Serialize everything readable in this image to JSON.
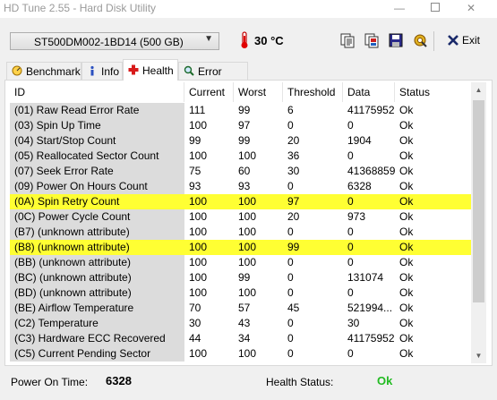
{
  "window": {
    "title": "HD Tune 2.55 - Hard Disk Utility",
    "minimize": "—",
    "close": "✕"
  },
  "toolbar": {
    "drive": "ST500DM002-1BD14 (500 GB)",
    "temperature": "30 °C",
    "exit_label": "Exit",
    "icons": [
      "copy-text-icon",
      "copy-screenshot-icon",
      "save-icon",
      "options-icon",
      "exit-icon"
    ]
  },
  "tabs": [
    {
      "label": "Benchmark",
      "icon": "benchmark-icon",
      "active": false
    },
    {
      "label": "Info",
      "icon": "info-icon",
      "active": false
    },
    {
      "label": "Health",
      "icon": "health-icon",
      "active": true
    },
    {
      "label": "Error Scan",
      "icon": "error-scan-icon",
      "active": false
    }
  ],
  "table": {
    "columns": [
      "ID",
      "Current",
      "Worst",
      "Threshold",
      "Data",
      "Status"
    ],
    "rows": [
      {
        "id": "(01) Raw Read Error Rate",
        "current": "111",
        "worst": "99",
        "threshold": "6",
        "data": "41175952",
        "status": "Ok",
        "highlight": false
      },
      {
        "id": "(03) Spin Up Time",
        "current": "100",
        "worst": "97",
        "threshold": "0",
        "data": "0",
        "status": "Ok",
        "highlight": false
      },
      {
        "id": "(04) Start/Stop Count",
        "current": "99",
        "worst": "99",
        "threshold": "20",
        "data": "1904",
        "status": "Ok",
        "highlight": false
      },
      {
        "id": "(05) Reallocated Sector Count",
        "current": "100",
        "worst": "100",
        "threshold": "36",
        "data": "0",
        "status": "Ok",
        "highlight": false
      },
      {
        "id": "(07) Seek Error Rate",
        "current": "75",
        "worst": "60",
        "threshold": "30",
        "data": "41368859",
        "status": "Ok",
        "highlight": false
      },
      {
        "id": "(09) Power On Hours Count",
        "current": "93",
        "worst": "93",
        "threshold": "0",
        "data": "6328",
        "status": "Ok",
        "highlight": false
      },
      {
        "id": "(0A) Spin Retry Count",
        "current": "100",
        "worst": "100",
        "threshold": "97",
        "data": "0",
        "status": "Ok",
        "highlight": true
      },
      {
        "id": "(0C) Power Cycle Count",
        "current": "100",
        "worst": "100",
        "threshold": "20",
        "data": "973",
        "status": "Ok",
        "highlight": false
      },
      {
        "id": "(B7) (unknown attribute)",
        "current": "100",
        "worst": "100",
        "threshold": "0",
        "data": "0",
        "status": "Ok",
        "highlight": false
      },
      {
        "id": "(B8) (unknown attribute)",
        "current": "100",
        "worst": "100",
        "threshold": "99",
        "data": "0",
        "status": "Ok",
        "highlight": true
      },
      {
        "id": "(BB) (unknown attribute)",
        "current": "100",
        "worst": "100",
        "threshold": "0",
        "data": "0",
        "status": "Ok",
        "highlight": false
      },
      {
        "id": "(BC) (unknown attribute)",
        "current": "100",
        "worst": "99",
        "threshold": "0",
        "data": "131074",
        "status": "Ok",
        "highlight": false
      },
      {
        "id": "(BD) (unknown attribute)",
        "current": "100",
        "worst": "100",
        "threshold": "0",
        "data": "0",
        "status": "Ok",
        "highlight": false
      },
      {
        "id": "(BE) Airflow Temperature",
        "current": "70",
        "worst": "57",
        "threshold": "45",
        "data": "521994...",
        "status": "Ok",
        "highlight": false
      },
      {
        "id": "(C2) Temperature",
        "current": "30",
        "worst": "43",
        "threshold": "0",
        "data": "30",
        "status": "Ok",
        "highlight": false
      },
      {
        "id": "(C3) Hardware ECC Recovered",
        "current": "44",
        "worst": "34",
        "threshold": "0",
        "data": "41175952",
        "status": "Ok",
        "highlight": false
      },
      {
        "id": "(C5) Current Pending Sector",
        "current": "100",
        "worst": "100",
        "threshold": "0",
        "data": "0",
        "status": "Ok",
        "highlight": false
      }
    ]
  },
  "status_bar": {
    "power_on_label": "Power On Time:",
    "power_on_value": "6328",
    "health_label": "Health Status:",
    "health_value": "Ok"
  },
  "colors": {
    "highlight": "#ffff33",
    "ok_green": "#22bb22",
    "id_column_bg": "#dcdcdc"
  }
}
